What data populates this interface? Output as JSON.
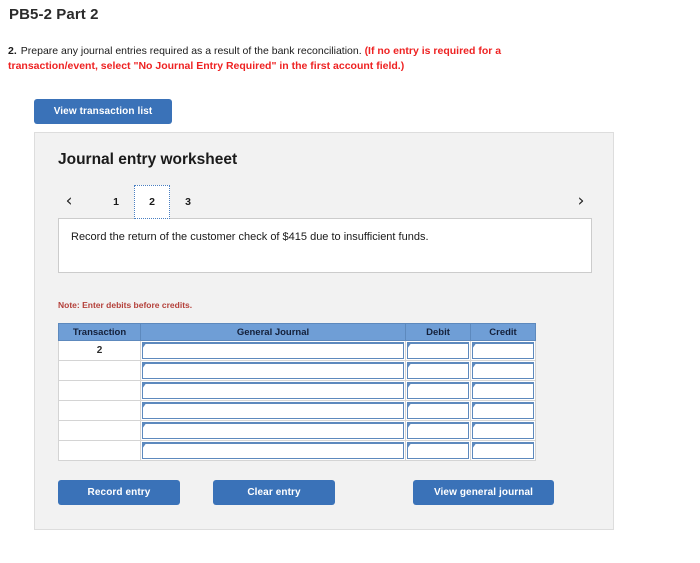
{
  "page": {
    "title": "PB5-2 Part 2"
  },
  "question": {
    "number": "2.",
    "text": "Prepare any journal entries required as a result of the bank reconciliation.",
    "emphasis": "(If no entry is required for a transaction/event, select \"No Journal Entry Required\" in the first account field.)"
  },
  "toolbar": {
    "view_transaction_list_label": "View transaction list"
  },
  "worksheet": {
    "title": "Journal entry worksheet",
    "pager": {
      "prev_icon": "‹",
      "next_icon": "›",
      "tabs": [
        {
          "label": "1",
          "active": false
        },
        {
          "label": "2",
          "active": true
        },
        {
          "label": "3",
          "active": false
        }
      ]
    },
    "description": "Record the return of the customer check of $415 due to insufficient funds.",
    "note": "Note: Enter debits before credits.",
    "table": {
      "headers": [
        "Transaction",
        "General Journal",
        "Debit",
        "Credit"
      ],
      "rows": [
        {
          "transaction": "2",
          "general_journal": "",
          "debit": "",
          "credit": ""
        },
        {
          "transaction": "",
          "general_journal": "",
          "debit": "",
          "credit": ""
        },
        {
          "transaction": "",
          "general_journal": "",
          "debit": "",
          "credit": ""
        },
        {
          "transaction": "",
          "general_journal": "",
          "debit": "",
          "credit": ""
        },
        {
          "transaction": "",
          "general_journal": "",
          "debit": "",
          "credit": ""
        },
        {
          "transaction": "",
          "general_journal": "",
          "debit": "",
          "credit": ""
        }
      ]
    },
    "actions": {
      "record_entry_label": "Record entry",
      "clear_entry_label": "Clear entry",
      "view_general_journal_label": "View general journal"
    }
  },
  "colors": {
    "button_blue": "#3a72b8",
    "table_header_blue": "#6f9ed6",
    "emphasis_red": "#ee2222",
    "note_red": "#b4403a",
    "panel_gray": "#f2f2f2"
  }
}
